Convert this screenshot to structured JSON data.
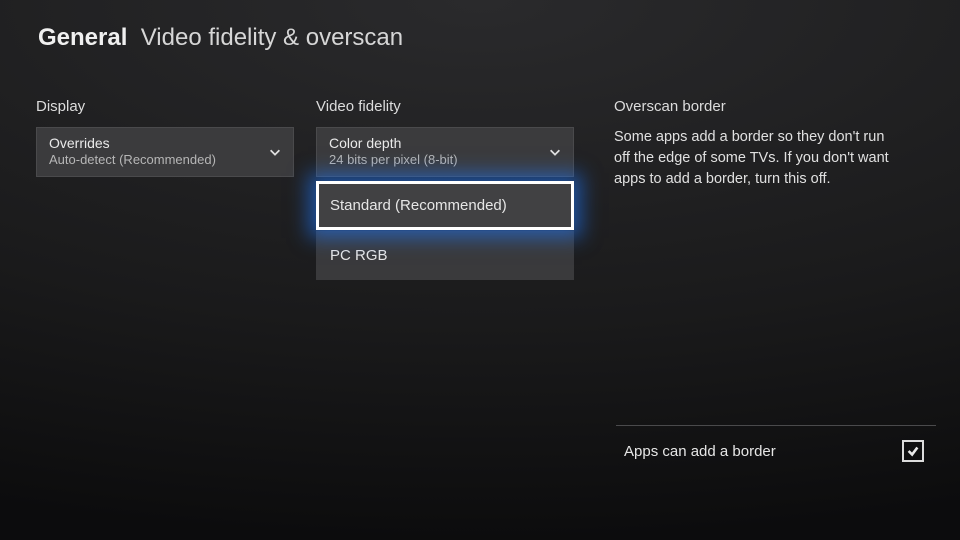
{
  "header": {
    "category": "General",
    "title": "Video fidelity & overscan"
  },
  "display": {
    "section_label": "Display",
    "overrides": {
      "label": "Overrides",
      "value": "Auto-detect (Recommended)"
    }
  },
  "fidelity": {
    "section_label": "Video fidelity",
    "color_depth": {
      "label": "Color depth",
      "value": "24 bits per pixel (8-bit)"
    },
    "color_space_options": [
      "Standard (Recommended)",
      "PC RGB"
    ],
    "color_space_selected": "Standard (Recommended)"
  },
  "overscan": {
    "section_label": "Overscan border",
    "description": "Some apps add a border so they don't run off the edge of some TVs. If you don't want apps to add a border, turn this off.",
    "toggle_label": "Apps can add a border",
    "toggle_checked": true
  }
}
